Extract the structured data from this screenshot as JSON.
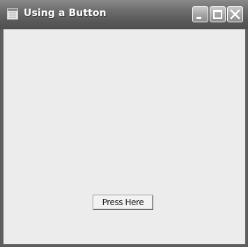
{
  "window": {
    "title": "Using a Button",
    "icon": "app-window-icon"
  },
  "titlebar_controls": {
    "minimize_icon": "minimize-icon",
    "maximize_icon": "maximize-icon",
    "close_icon": "close-icon"
  },
  "main": {
    "button_label": "Press Here"
  }
}
